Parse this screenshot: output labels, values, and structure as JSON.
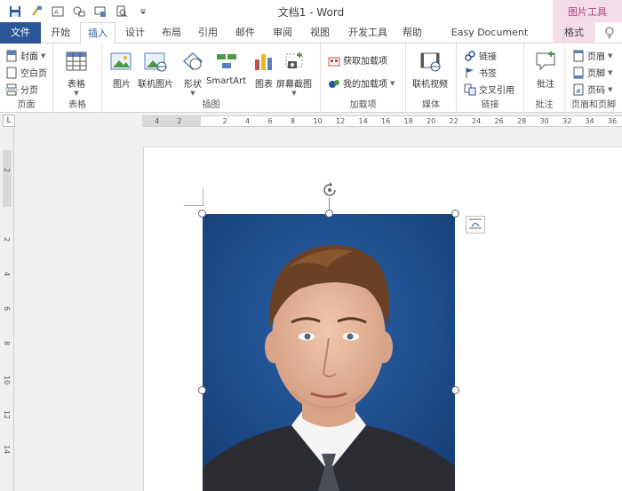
{
  "window": {
    "title": "文档1 - Word",
    "context_tab_title": "图片工具"
  },
  "qat": {
    "items": [
      "save-icon",
      "format-painter-icon",
      "textbox-icon",
      "shapes-icon",
      "screen-icon",
      "preview-icon",
      "customize-icon"
    ]
  },
  "tabs": {
    "file": "文件",
    "home": "开始",
    "insert": "插入",
    "design": "设计",
    "layout": "布局",
    "references": "引用",
    "mailings": "邮件",
    "review": "审阅",
    "view": "视图",
    "developer": "开发工具",
    "help": "帮助",
    "easy_doc": "Easy Document Creator",
    "format": "格式"
  },
  "ribbon": {
    "pages": {
      "label": "页面",
      "cover": "封面",
      "blank": "空白页",
      "break": "分页"
    },
    "tables": {
      "label": "表格",
      "table": "表格"
    },
    "illustrations": {
      "label": "插图",
      "picture": "图片",
      "online_picture": "联机图片",
      "shapes": "形状",
      "smartart": "SmartArt",
      "chart": "图表",
      "screenshot": "屏幕截图"
    },
    "addins": {
      "label": "加载项",
      "get": "获取加载项",
      "my": "我的加载项"
    },
    "media": {
      "label": "媒体",
      "online_video": "联机视频"
    },
    "links": {
      "label": "链接",
      "link": "链接",
      "bookmark": "书签",
      "cross_ref": "交叉引用"
    },
    "comments": {
      "label": "批注",
      "comment": "批注"
    },
    "header_footer": {
      "label": "页眉和页脚",
      "header": "页眉",
      "footer": "页脚",
      "page_number": "页码"
    }
  },
  "ruler": {
    "corner": "L",
    "h_numbers": [
      "4",
      "2",
      "",
      "2",
      "4",
      "6",
      "8",
      "10",
      "12",
      "14",
      "16",
      "18",
      "20",
      "22",
      "24",
      "26",
      "28",
      "30",
      "32",
      "34",
      "36"
    ],
    "v_numbers": [
      "2",
      "",
      "2",
      "4",
      "6",
      "8",
      "10",
      "12",
      "14"
    ]
  },
  "colors": {
    "accent": "#2b579a",
    "context_tab": "#f2dde8",
    "context_text": "#b4407d",
    "photo_background": "#1d4e8f"
  }
}
